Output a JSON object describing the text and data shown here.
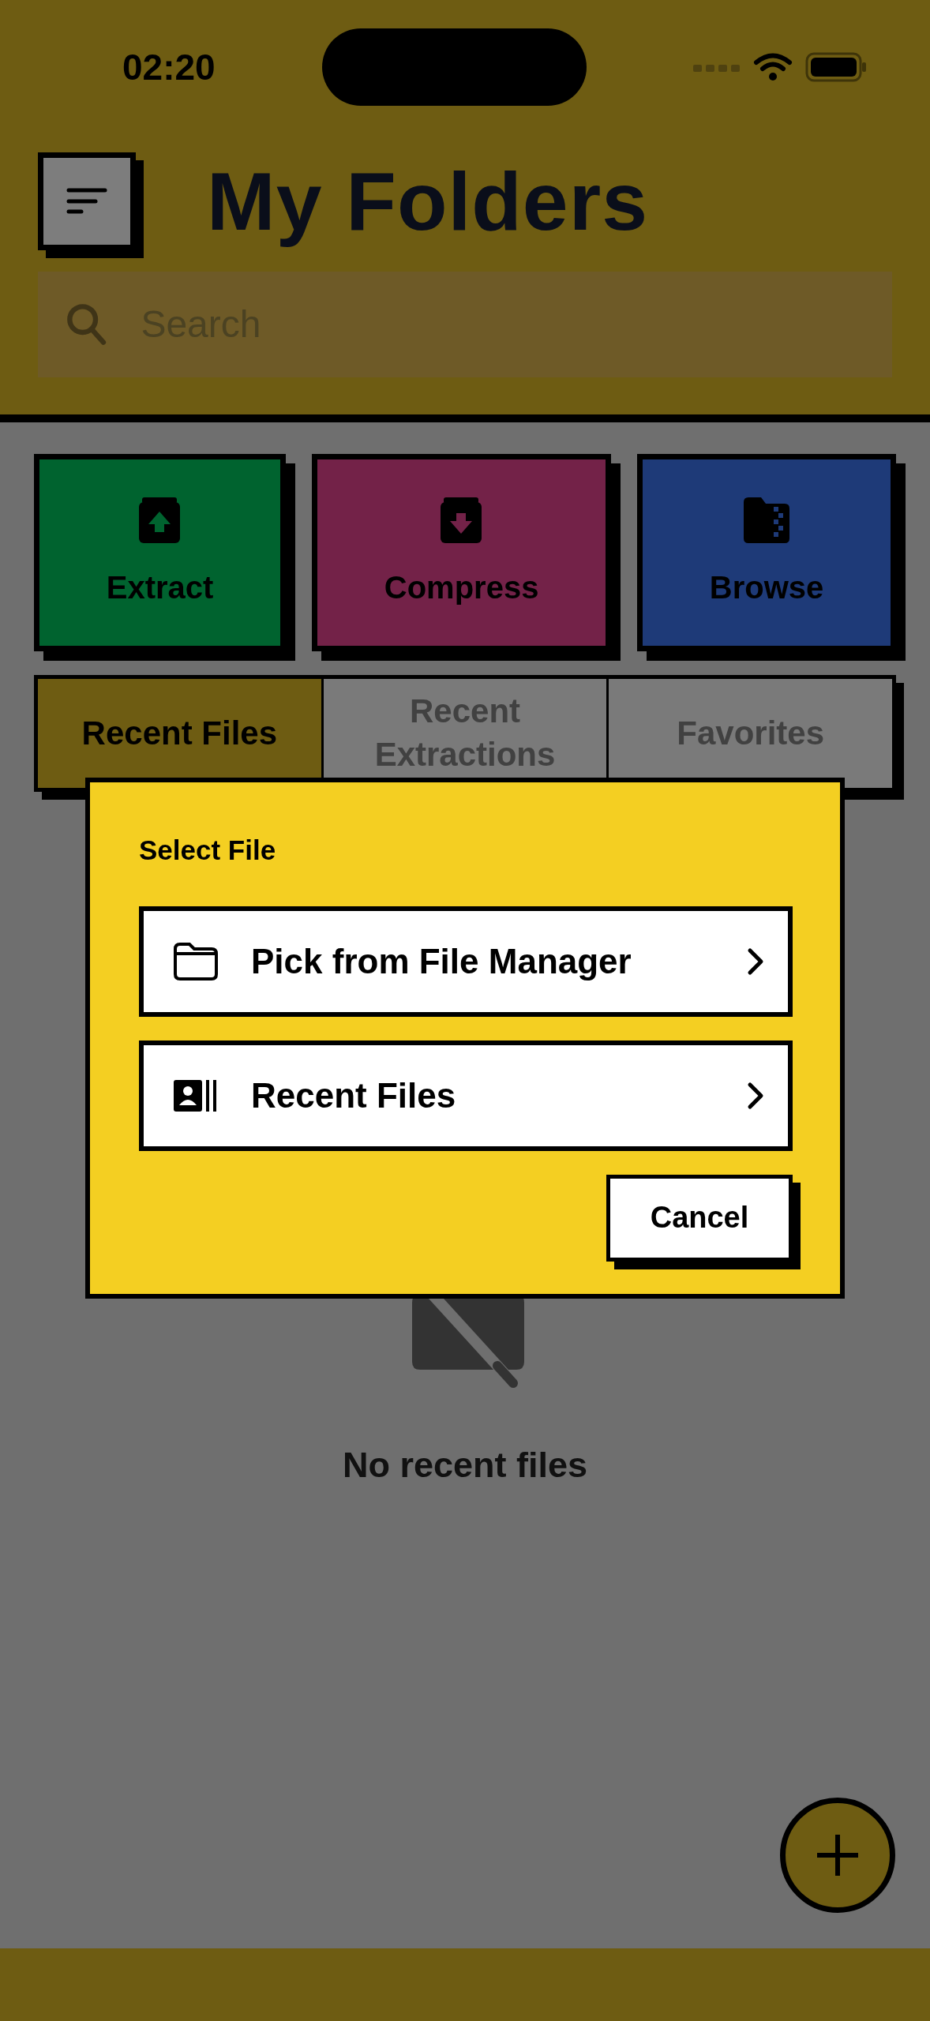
{
  "status_bar": {
    "time": "02:20"
  },
  "header": {
    "title": "My Folders",
    "search": {
      "placeholder": "Search"
    }
  },
  "actions": [
    {
      "label": "Extract",
      "kind": "extract",
      "color": "#00632f"
    },
    {
      "label": "Compress",
      "kind": "compress",
      "color": "#732248"
    },
    {
      "label": "Browse",
      "kind": "browse",
      "color": "#1e3a78"
    }
  ],
  "tabs": [
    {
      "label": "Recent Files",
      "selected": true
    },
    {
      "label": "Recent Extractions",
      "selected": false
    },
    {
      "label": "Favorites",
      "selected": false
    }
  ],
  "empty_state": {
    "message": "No recent files"
  },
  "dialog": {
    "title": "Select File",
    "options": [
      {
        "label": "Pick from File Manager",
        "kind": "folder"
      },
      {
        "label": "Recent Files",
        "kind": "recent"
      }
    ],
    "cancel": "Cancel"
  }
}
